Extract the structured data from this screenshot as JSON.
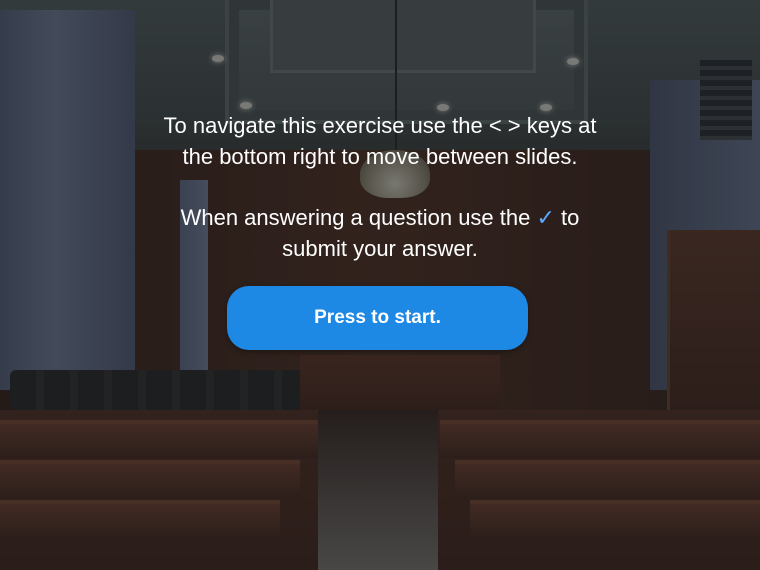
{
  "intro": {
    "line1_a": "To navigate this exercise use the < > keys at",
    "line1_b": "the bottom right to move between slides.",
    "line2_a": "When answering a question use the",
    "line2_check": "✓",
    "line2_b": "to",
    "line2_c": "submit your answer."
  },
  "start_button": {
    "label": "Press to start."
  },
  "colors": {
    "button": "#1e88e5",
    "check": "#5aa8ff"
  }
}
